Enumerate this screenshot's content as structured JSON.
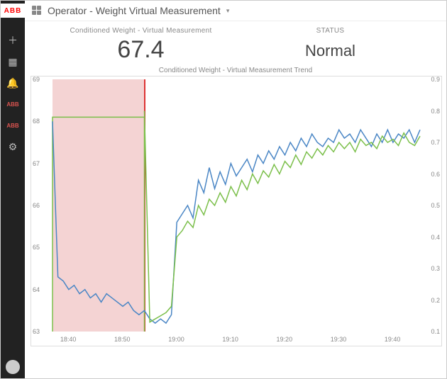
{
  "brand": "ABB",
  "titlebar": {
    "title": "Operator - Weight Virtual Measurement",
    "hasDropdown": true
  },
  "sidebar": {
    "items": [
      {
        "name": "add-icon",
        "glyph": "＋"
      },
      {
        "name": "grid-icon",
        "glyph": "▦"
      },
      {
        "name": "bell-icon",
        "glyph": "🔔"
      },
      {
        "name": "abb-icon-1",
        "glyph": "ABB",
        "red": true
      },
      {
        "name": "abb-icon-2",
        "glyph": "ABB",
        "red": true
      },
      {
        "name": "gear-icon",
        "glyph": "⚙"
      }
    ]
  },
  "summary": {
    "metric_label": "Conditioned Weight - Virtual Measurement",
    "metric_value": "67.4",
    "status_label": "STATUS",
    "status_value": "Normal"
  },
  "chart_data": {
    "type": "line",
    "title": "Conditioned Weight - Virtual Measurement Trend",
    "xlabel": "",
    "ylabel_left": "",
    "ylabel_right": "",
    "x_ticks": [
      "18:40",
      "18:50",
      "19:00",
      "19:10",
      "19:20",
      "19:30",
      "19:40"
    ],
    "y_left_ticks": [
      63,
      64,
      65,
      66,
      67,
      68,
      69
    ],
    "y_right_ticks": [
      0.1,
      0.2,
      0.3,
      0.4,
      0.5,
      0.6,
      0.7,
      0.8,
      0.9
    ],
    "ylim_left": [
      63,
      69
    ],
    "ylim_right": [
      0.1,
      0.9
    ],
    "xlim_minutes": [
      1117,
      1185
    ],
    "shaded_region_x": [
      1117,
      1134
    ],
    "vertical_marker_x": 1134,
    "green_step_region": {
      "x_from": 1117,
      "x_to": 1134,
      "y_left": 68.1
    },
    "series": [
      {
        "name": "blue",
        "axis": "left",
        "color": "#4a86c5",
        "x_minutes": [
          1117,
          1118,
          1119,
          1120,
          1121,
          1122,
          1123,
          1124,
          1125,
          1126,
          1127,
          1128,
          1129,
          1130,
          1131,
          1132,
          1133,
          1134,
          1135,
          1136,
          1137,
          1138,
          1139,
          1140,
          1141,
          1142,
          1143,
          1144,
          1145,
          1146,
          1147,
          1148,
          1149,
          1150,
          1151,
          1152,
          1153,
          1154,
          1155,
          1156,
          1157,
          1158,
          1159,
          1160,
          1161,
          1162,
          1163,
          1164,
          1165,
          1166,
          1167,
          1168,
          1169,
          1170,
          1171,
          1172,
          1173,
          1174,
          1175,
          1176,
          1177,
          1178,
          1179,
          1180,
          1181,
          1182,
          1183,
          1184,
          1185
        ],
        "y": [
          68.0,
          64.3,
          64.2,
          64.0,
          64.1,
          63.9,
          64.0,
          63.8,
          63.9,
          63.7,
          63.9,
          63.8,
          63.7,
          63.6,
          63.7,
          63.5,
          63.4,
          63.5,
          63.3,
          63.2,
          63.3,
          63.2,
          63.4,
          65.6,
          65.8,
          66.0,
          65.7,
          66.6,
          66.3,
          66.9,
          66.4,
          66.8,
          66.5,
          67.0,
          66.7,
          66.9,
          67.1,
          66.8,
          67.2,
          67.0,
          67.3,
          67.1,
          67.4,
          67.2,
          67.5,
          67.3,
          67.6,
          67.4,
          67.7,
          67.5,
          67.4,
          67.6,
          67.5,
          67.8,
          67.6,
          67.7,
          67.5,
          67.8,
          67.6,
          67.4,
          67.7,
          67.5,
          67.8,
          67.5,
          67.7,
          67.6,
          67.8,
          67.5,
          67.8
        ]
      },
      {
        "name": "green",
        "axis": "right",
        "color": "#7bbf4a",
        "x_minutes": [
          1134,
          1135,
          1136,
          1137,
          1138,
          1139,
          1140,
          1141,
          1142,
          1143,
          1144,
          1145,
          1146,
          1147,
          1148,
          1149,
          1150,
          1151,
          1152,
          1153,
          1154,
          1155,
          1156,
          1157,
          1158,
          1159,
          1160,
          1161,
          1162,
          1163,
          1164,
          1165,
          1166,
          1167,
          1168,
          1169,
          1170,
          1171,
          1172,
          1173,
          1174,
          1175,
          1176,
          1177,
          1178,
          1179,
          1180,
          1181,
          1182,
          1183,
          1184,
          1185
        ],
        "y": [
          0.8,
          0.13,
          0.14,
          0.15,
          0.16,
          0.18,
          0.4,
          0.42,
          0.45,
          0.43,
          0.5,
          0.47,
          0.52,
          0.5,
          0.54,
          0.51,
          0.56,
          0.53,
          0.58,
          0.55,
          0.6,
          0.57,
          0.61,
          0.59,
          0.63,
          0.6,
          0.64,
          0.62,
          0.66,
          0.63,
          0.67,
          0.65,
          0.68,
          0.66,
          0.69,
          0.67,
          0.7,
          0.68,
          0.7,
          0.67,
          0.71,
          0.69,
          0.7,
          0.68,
          0.72,
          0.7,
          0.71,
          0.69,
          0.73,
          0.7,
          0.69,
          0.72
        ]
      }
    ]
  }
}
